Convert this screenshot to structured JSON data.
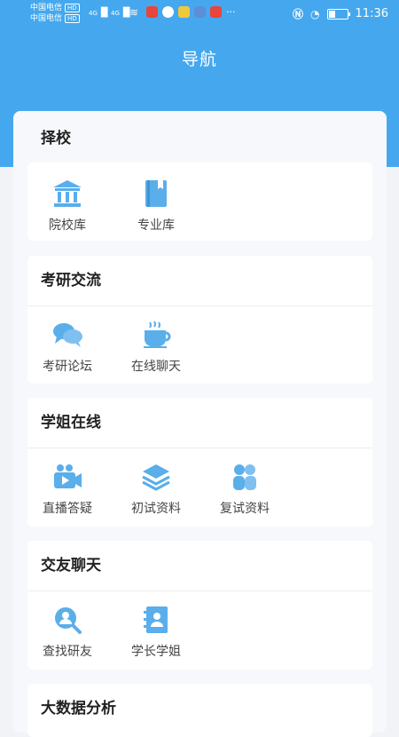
{
  "status_bar": {
    "carrier1": "中国电信",
    "carrier2": "中国电信",
    "hd": "HD",
    "network": "4G",
    "time": "11:36",
    "more": "···"
  },
  "header": {
    "title": "导航",
    "color": "#45a8ee"
  },
  "sections": [
    {
      "title": "择校",
      "items": [
        {
          "label": "院校库",
          "icon": "bank-icon"
        },
        {
          "label": "专业库",
          "icon": "book-icon"
        }
      ]
    },
    {
      "title": "考研交流",
      "items": [
        {
          "label": "考研论坛",
          "icon": "chat-bubbles-icon"
        },
        {
          "label": "在线聊天",
          "icon": "coffee-cup-icon"
        }
      ]
    },
    {
      "title": "学姐在线",
      "items": [
        {
          "label": "直播答疑",
          "icon": "video-camera-icon"
        },
        {
          "label": "初试资料",
          "icon": "layers-icon"
        },
        {
          "label": "复试资料",
          "icon": "people-icon"
        }
      ]
    },
    {
      "title": "交友聊天",
      "items": [
        {
          "label": "查找研友",
          "icon": "user-search-icon"
        },
        {
          "label": "学长学姐",
          "icon": "contacts-book-icon"
        }
      ]
    },
    {
      "title": "大数据分析",
      "items": []
    }
  ],
  "accent_color": "#5aaeea"
}
